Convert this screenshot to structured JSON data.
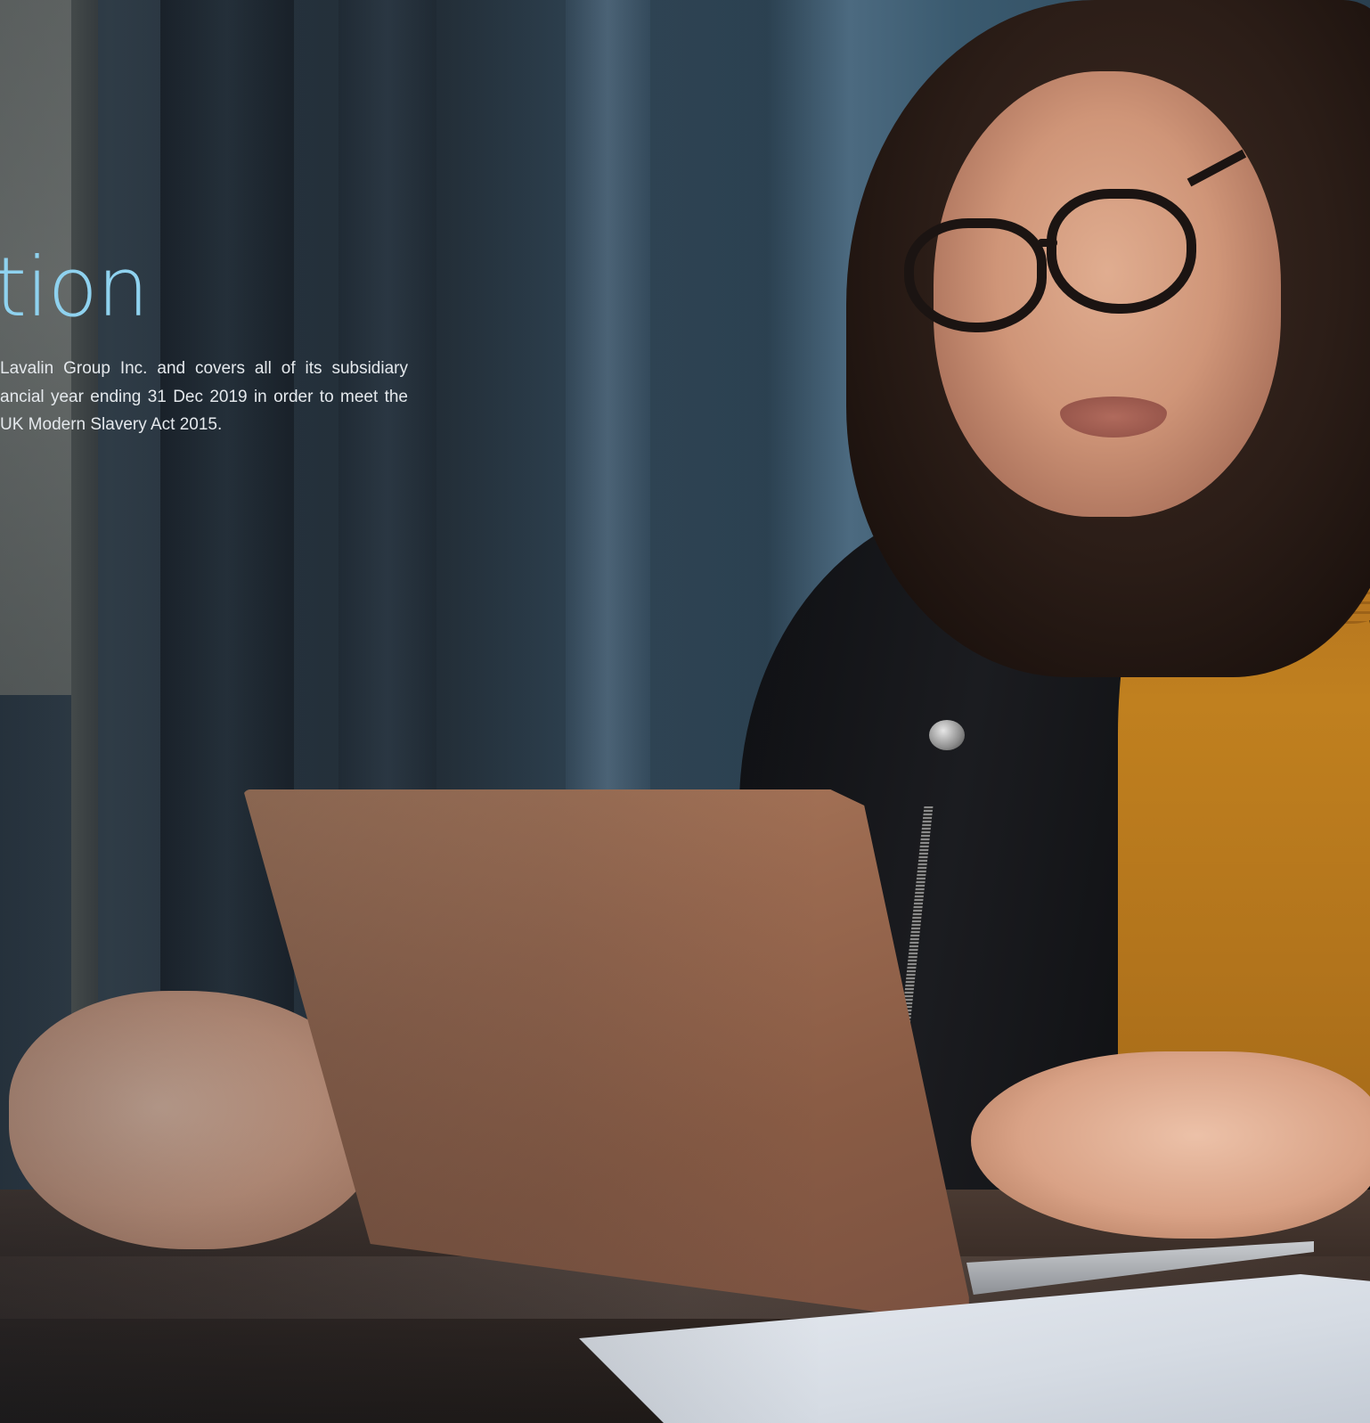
{
  "heading": "tion",
  "body_lines": [
    "Lavalin Group Inc. and covers all of its subsidiary",
    "ancial year ending 31 Dec 2019 in order to meet the",
    "UK Modern Slavery Act 2015."
  ],
  "colors": {
    "heading": "#8fd2ef",
    "body_text": "#e4e8ec"
  }
}
